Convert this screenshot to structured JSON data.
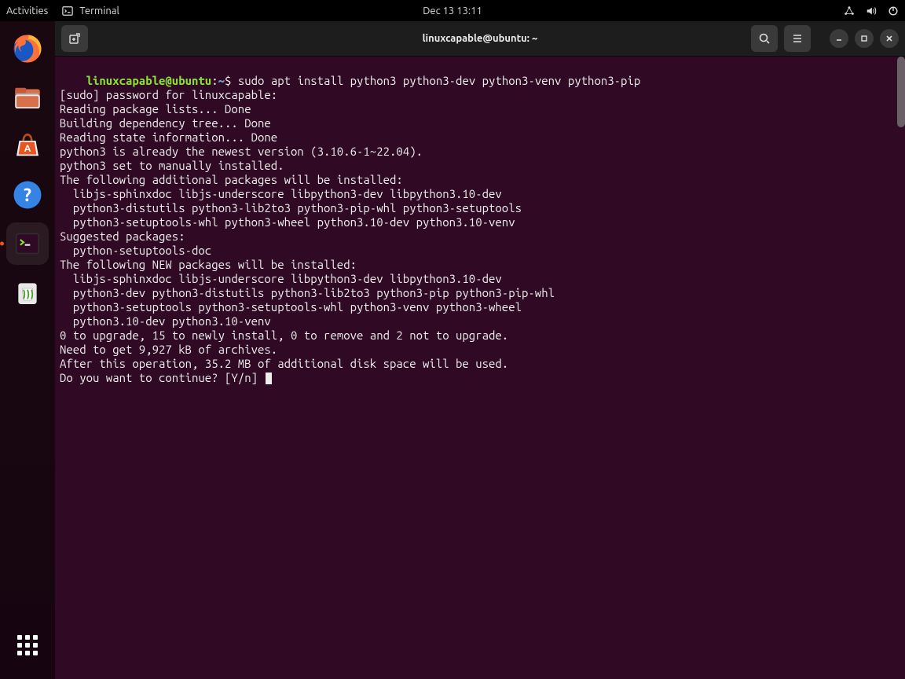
{
  "topbar": {
    "activities": "Activities",
    "app_name": "Terminal",
    "datetime": "Dec 13  13:11"
  },
  "window": {
    "title": "linuxcapable@ubuntu: ~"
  },
  "terminal": {
    "prompt_user": "linuxcapable@ubuntu",
    "prompt_colon": ":",
    "prompt_path": "~",
    "prompt_dollar": "$ ",
    "command": "sudo apt install python3 python3-dev python3-venv python3-pip",
    "lines": [
      "[sudo] password for linuxcapable: ",
      "Reading package lists... Done",
      "Building dependency tree... Done",
      "Reading state information... Done",
      "python3 is already the newest version (3.10.6-1~22.04).",
      "python3 set to manually installed.",
      "The following additional packages will be installed:",
      "  libjs-sphinxdoc libjs-underscore libpython3-dev libpython3.10-dev",
      "  python3-distutils python3-lib2to3 python3-pip-whl python3-setuptools",
      "  python3-setuptools-whl python3-wheel python3.10-dev python3.10-venv",
      "Suggested packages:",
      "  python-setuptools-doc",
      "The following NEW packages will be installed:",
      "  libjs-sphinxdoc libjs-underscore libpython3-dev libpython3.10-dev",
      "  python3-dev python3-distutils python3-lib2to3 python3-pip python3-pip-whl",
      "  python3-setuptools python3-setuptools-whl python3-venv python3-wheel",
      "  python3.10-dev python3.10-venv",
      "0 to upgrade, 15 to newly install, 0 to remove and 2 not to upgrade.",
      "Need to get 9,927 kB of archives.",
      "After this operation, 35.2 MB of additional disk space will be used.",
      "Do you want to continue? [Y/n] "
    ]
  }
}
